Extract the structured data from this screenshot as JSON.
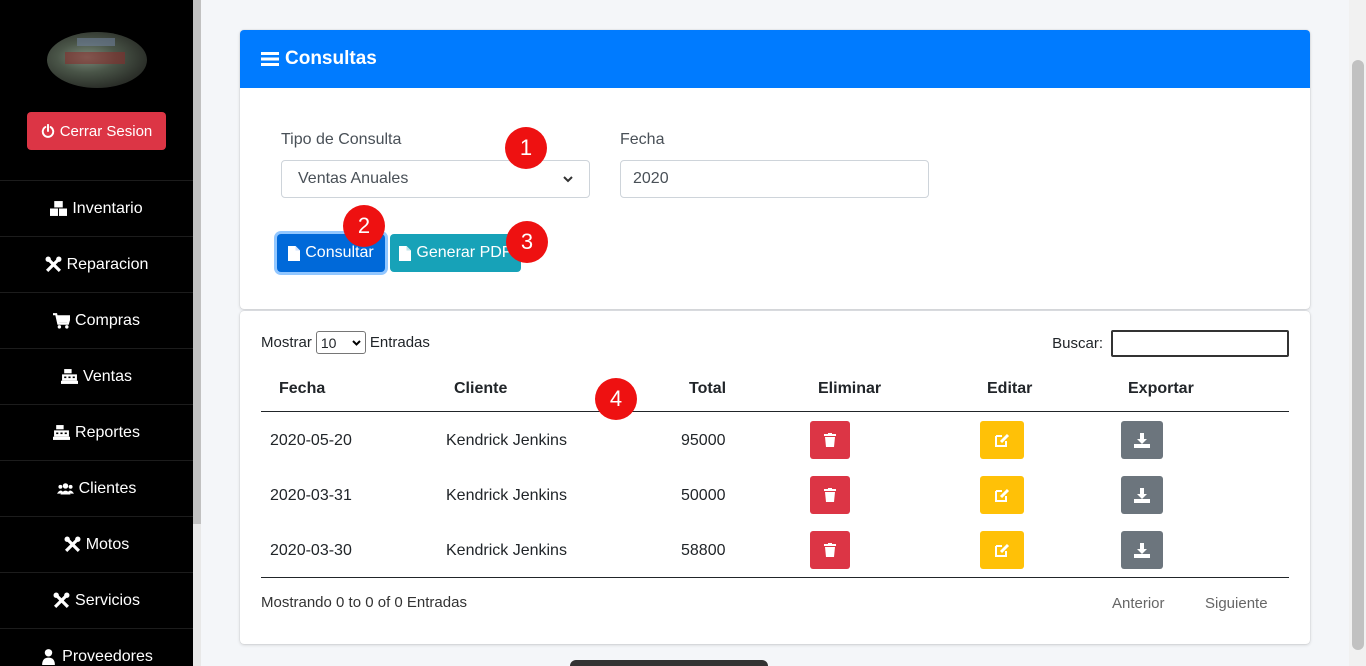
{
  "sidebar": {
    "logout_label": "Cerrar Sesion",
    "items": [
      {
        "label": "Inventario",
        "icon": "boxes-icon"
      },
      {
        "label": "Reparacion",
        "icon": "tools-icon"
      },
      {
        "label": "Compras",
        "icon": "cart-icon"
      },
      {
        "label": "Ventas",
        "icon": "cash-register-icon"
      },
      {
        "label": "Reportes",
        "icon": "cash-register-icon"
      },
      {
        "label": "Clientes",
        "icon": "users-icon"
      },
      {
        "label": "Motos",
        "icon": "tools-icon"
      },
      {
        "label": "Servicios",
        "icon": "tools-icon"
      },
      {
        "label": "Proveedores",
        "icon": "user-icon"
      }
    ]
  },
  "card": {
    "title": "Consultas",
    "tipo_label": "Tipo de Consulta",
    "tipo_value": "Ventas Anuales",
    "fecha_label": "Fecha",
    "fecha_value": "2020",
    "consultar_label": "Consultar",
    "pdf_label": "Generar PDF"
  },
  "annotations": [
    "1",
    "2",
    "3",
    "4"
  ],
  "table": {
    "show_label": "Mostrar",
    "length_value": "10",
    "entries_label": "Entradas",
    "search_label": "Buscar:",
    "headers": [
      "Fecha",
      "Cliente",
      "Total",
      "Eliminar",
      "Editar",
      "Exportar"
    ],
    "rows": [
      {
        "fecha": "2020-05-20",
        "cliente": "Kendrick Jenkins",
        "total": "95000"
      },
      {
        "fecha": "2020-03-31",
        "cliente": "Kendrick Jenkins",
        "total": "50000"
      },
      {
        "fecha": "2020-03-30",
        "cliente": "Kendrick Jenkins",
        "total": "58800"
      }
    ],
    "info": "Mostrando 0 to 0 of 0 Entradas",
    "prev_label": "Anterior",
    "next_label": "Siguiente"
  },
  "colors": {
    "primary": "#007bff",
    "danger": "#dc3545",
    "warning": "#ffc107",
    "info": "#17a2b8",
    "secondary": "#6c757d",
    "annotation": "#ee1111"
  }
}
